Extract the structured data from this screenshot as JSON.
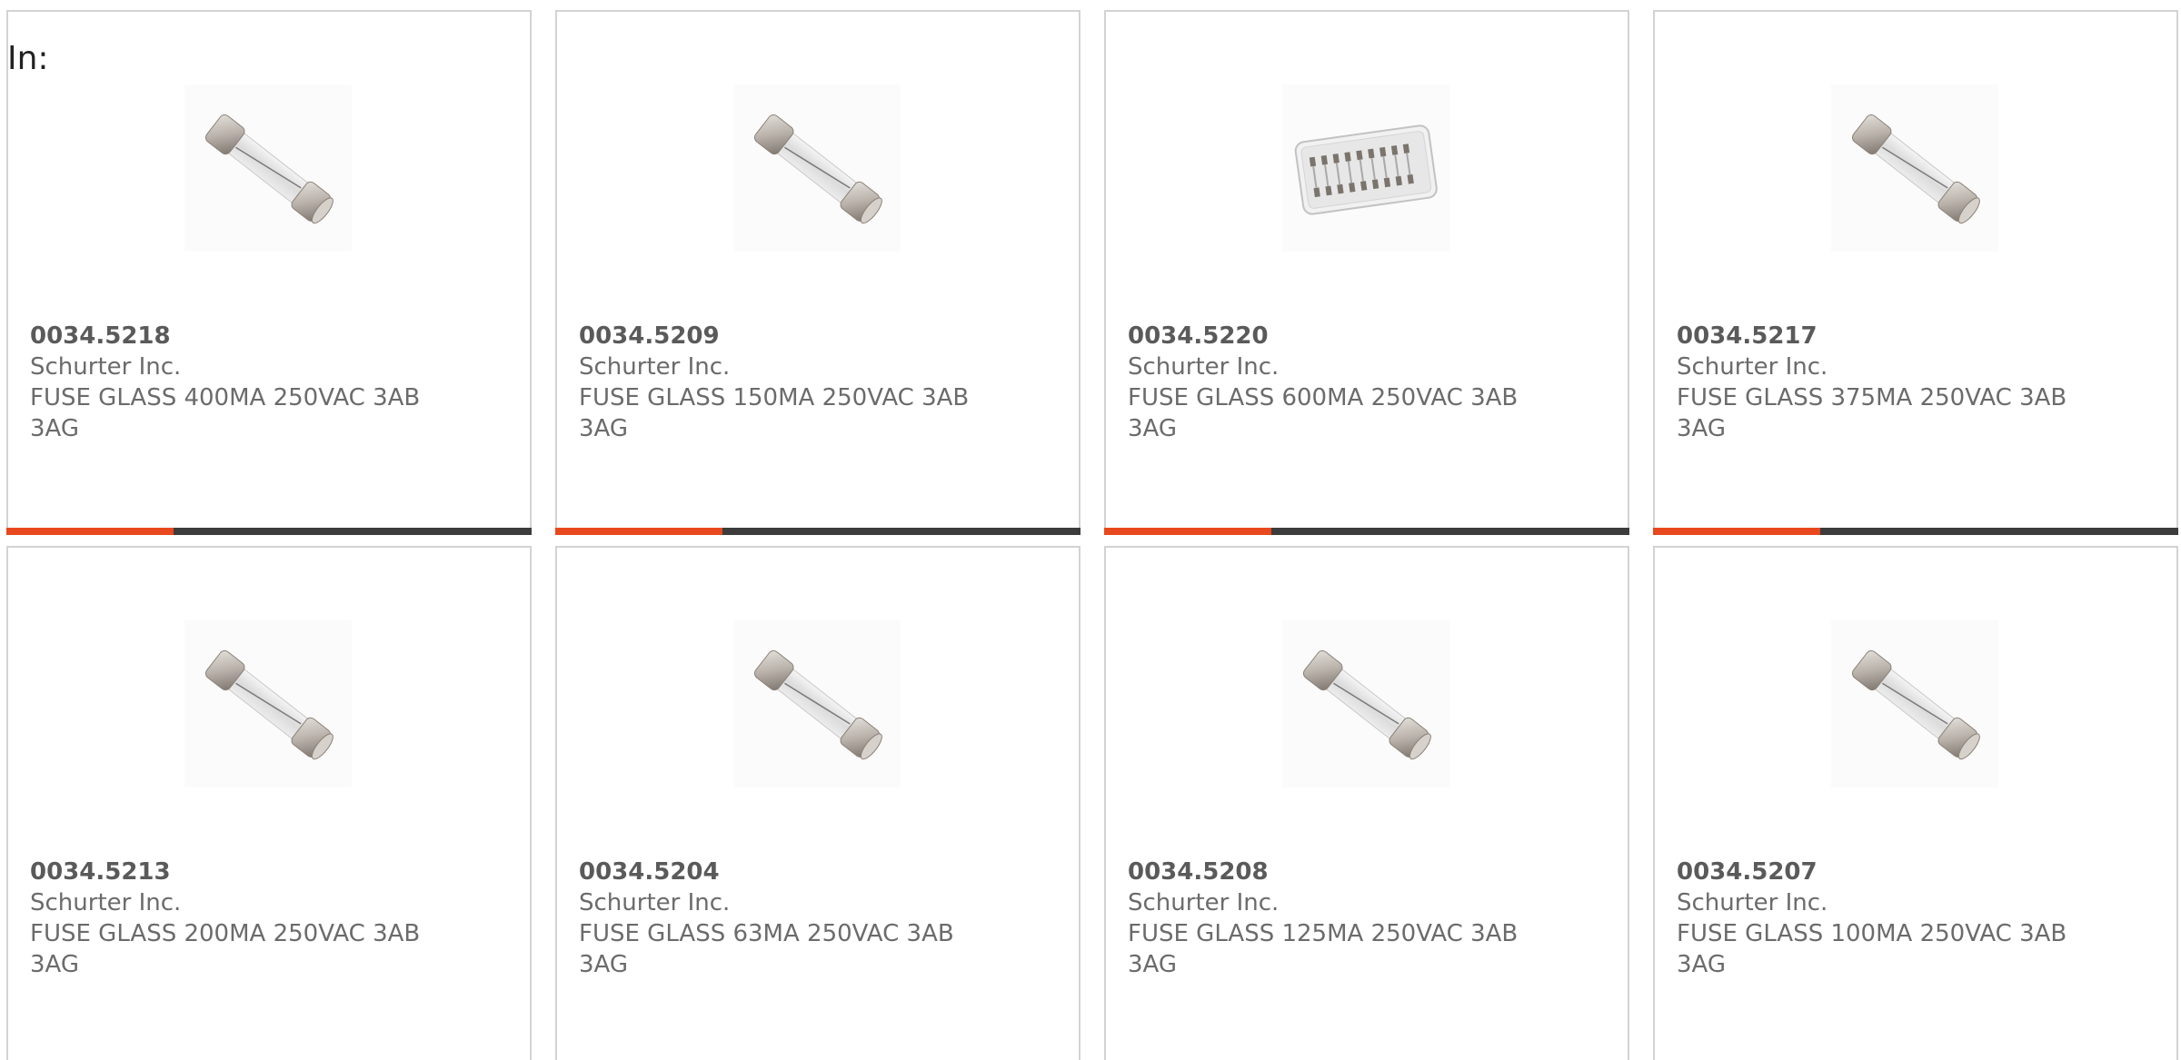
{
  "header": {
    "in_label": "In:"
  },
  "colors": {
    "accent": "#e8481d",
    "bar_dark": "#3c3c3c",
    "border": "#d3d3d3",
    "text": "#6b6b6b"
  },
  "products": [
    {
      "part_number": "0034.5218",
      "manufacturer": "Schurter Inc.",
      "description": "FUSE GLASS 400MA 250VAC 3AB 3AG",
      "image_icon": "glass-fuse-icon"
    },
    {
      "part_number": "0034.5209",
      "manufacturer": "Schurter Inc.",
      "description": "FUSE GLASS 150MA 250VAC 3AB 3AG",
      "image_icon": "glass-fuse-icon"
    },
    {
      "part_number": "0034.5220",
      "manufacturer": "Schurter Inc.",
      "description": "FUSE GLASS 600MA 250VAC 3AB 3AG",
      "image_icon": "fuse-pack-icon"
    },
    {
      "part_number": "0034.5217",
      "manufacturer": "Schurter Inc.",
      "description": "FUSE GLASS 375MA 250VAC 3AB 3AG",
      "image_icon": "glass-fuse-icon"
    },
    {
      "part_number": "0034.5213",
      "manufacturer": "Schurter Inc.",
      "description": "FUSE GLASS 200MA 250VAC 3AB 3AG",
      "image_icon": "glass-fuse-icon"
    },
    {
      "part_number": "0034.5204",
      "manufacturer": "Schurter Inc.",
      "description": "FUSE GLASS 63MA 250VAC 3AB 3AG",
      "image_icon": "glass-fuse-icon"
    },
    {
      "part_number": "0034.5208",
      "manufacturer": "Schurter Inc.",
      "description": "FUSE GLASS 125MA 250VAC 3AB 3AG",
      "image_icon": "glass-fuse-icon"
    },
    {
      "part_number": "0034.5207",
      "manufacturer": "Schurter Inc.",
      "description": "FUSE GLASS 100MA 250VAC 3AB 3AG",
      "image_icon": "glass-fuse-icon"
    }
  ]
}
